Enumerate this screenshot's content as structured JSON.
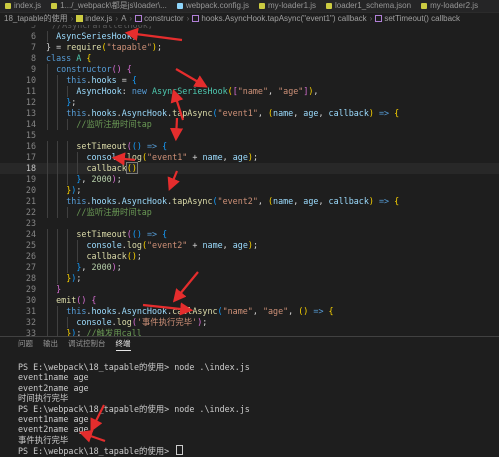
{
  "tabs": [
    {
      "label": "index.js",
      "sub": "",
      "icon": "js-file-icon"
    },
    {
      "label": "1.../_webpack\\都是js\\loader\\...",
      "sub": "",
      "icon": "js-file-icon"
    },
    {
      "label": "webpack.config.js",
      "sub": "",
      "icon": "webpack-file-icon"
    },
    {
      "label": "my-loader1.js",
      "sub": "",
      "icon": "js-file-icon"
    },
    {
      "label": "loader1_schema.json",
      "sub": "",
      "icon": "json-file-icon"
    },
    {
      "label": "my-loader2.js",
      "sub": "",
      "icon": "js-file-icon"
    }
  ],
  "breadcrumbs": [
    "18_tapable的使用",
    "index.js",
    "A",
    "constructor",
    "hooks.AsyncHook.tapAsync(\"event1\") callback",
    "setTimeout() callback"
  ],
  "editor": {
    "active_line": "18",
    "lines": [
      {
        "n": "6",
        "indent": 1,
        "tokens": [
          [
            "tk-var",
            "AsyncSeriesHook"
          ],
          [
            "tk-pun",
            ","
          ]
        ]
      },
      {
        "n": "7",
        "indent": 0,
        "tokens": [
          [
            "tk-pun",
            "} = "
          ],
          [
            "tk-fn",
            "require"
          ],
          [
            "tk-brk",
            "("
          ],
          [
            "tk-str",
            "\"tapable\""
          ],
          [
            "tk-brk",
            ")"
          ],
          [
            "tk-pun",
            ";"
          ]
        ]
      },
      {
        "n": "8",
        "indent": 0,
        "tokens": [
          [
            "tk-key",
            "class "
          ],
          [
            "tk-cls",
            "A"
          ],
          [
            "tk-pun",
            " "
          ],
          [
            "tk-brk",
            "{"
          ]
        ]
      },
      {
        "n": "9",
        "indent": 1,
        "tokens": [
          [
            "tk-key",
            "constructor"
          ],
          [
            "tk-brk2",
            "()"
          ],
          [
            "tk-pun",
            " "
          ],
          [
            "tk-brk2",
            "{"
          ]
        ]
      },
      {
        "n": "10",
        "indent": 2,
        "tokens": [
          [
            "tk-key",
            "this"
          ],
          [
            "tk-pun",
            "."
          ],
          [
            "tk-var",
            "hooks"
          ],
          [
            "tk-pun",
            " = "
          ],
          [
            "tk-brk3",
            "{"
          ]
        ]
      },
      {
        "n": "11",
        "indent": 3,
        "tokens": [
          [
            "tk-var",
            "AsyncHook"
          ],
          [
            "tk-pun",
            ": "
          ],
          [
            "tk-key",
            "new "
          ],
          [
            "tk-cls",
            "AsyncSeriesHook"
          ],
          [
            "tk-brk",
            "("
          ],
          [
            "tk-brk2",
            "["
          ],
          [
            "tk-str",
            "\"name\""
          ],
          [
            "tk-pun",
            ", "
          ],
          [
            "tk-str",
            "\"age\""
          ],
          [
            "tk-brk2",
            "]"
          ],
          [
            "tk-brk",
            ")"
          ],
          [
            "tk-pun",
            ","
          ]
        ]
      },
      {
        "n": "12",
        "indent": 2,
        "tokens": [
          [
            "tk-brk3",
            "}"
          ],
          [
            "tk-pun",
            ";"
          ]
        ]
      },
      {
        "n": "13",
        "indent": 2,
        "tokens": [
          [
            "tk-key",
            "this"
          ],
          [
            "tk-pun",
            "."
          ],
          [
            "tk-var",
            "hooks"
          ],
          [
            "tk-pun",
            "."
          ],
          [
            "tk-var",
            "AsyncHook"
          ],
          [
            "tk-pun",
            "."
          ],
          [
            "tk-fn",
            "tapAsync"
          ],
          [
            "tk-brk3",
            "("
          ],
          [
            "tk-str",
            "\"event1\""
          ],
          [
            "tk-pun",
            ", "
          ],
          [
            "tk-brk",
            "("
          ],
          [
            "tk-var",
            "name"
          ],
          [
            "tk-pun",
            ", "
          ],
          [
            "tk-var",
            "age"
          ],
          [
            "tk-pun",
            ", "
          ],
          [
            "tk-var",
            "callback"
          ],
          [
            "tk-brk",
            ")"
          ],
          [
            "tk-pun",
            " "
          ],
          [
            "tk-key",
            "=>"
          ],
          [
            "tk-pun",
            " "
          ],
          [
            "tk-brk",
            "{"
          ]
        ]
      },
      {
        "n": "14",
        "indent": 3,
        "tokens": [
          [
            "tk-com",
            "//监听注册时间tap"
          ]
        ]
      },
      {
        "n": "15",
        "indent": 0,
        "tokens": []
      },
      {
        "n": "16",
        "indent": 3,
        "tokens": [
          [
            "tk-fn",
            "setTimeout"
          ],
          [
            "tk-brk2",
            "("
          ],
          [
            "tk-brk3",
            "()"
          ],
          [
            "tk-pun",
            " "
          ],
          [
            "tk-key",
            "=>"
          ],
          [
            "tk-pun",
            " "
          ],
          [
            "tk-brk3",
            "{"
          ]
        ]
      },
      {
        "n": "17",
        "indent": 4,
        "tokens": [
          [
            "tk-var",
            "console"
          ],
          [
            "tk-pun",
            "."
          ],
          [
            "tk-fn",
            "log"
          ],
          [
            "tk-brk",
            "("
          ],
          [
            "tk-str",
            "\"event1\""
          ],
          [
            "tk-pun",
            " + "
          ],
          [
            "tk-var",
            "name"
          ],
          [
            "tk-pun",
            ", "
          ],
          [
            "tk-var",
            "age"
          ],
          [
            "tk-brk",
            ")"
          ],
          [
            "tk-pun",
            ";"
          ]
        ]
      },
      {
        "n": "18",
        "indent": 4,
        "tokens": [
          [
            "tk-fn",
            "callback"
          ],
          [
            "tk-brk",
            "()"
          ]
        ]
      },
      {
        "n": "19",
        "indent": 3,
        "tokens": [
          [
            "tk-brk3",
            "}"
          ],
          [
            "tk-pun",
            ", "
          ],
          [
            "tk-num",
            "2000"
          ],
          [
            "tk-brk2",
            ")"
          ],
          [
            "tk-pun",
            ";"
          ]
        ]
      },
      {
        "n": "20",
        "indent": 2,
        "tokens": [
          [
            "tk-brk",
            "}"
          ],
          [
            "tk-brk3",
            ")"
          ],
          [
            "tk-pun",
            ";"
          ]
        ]
      },
      {
        "n": "21",
        "indent": 2,
        "tokens": [
          [
            "tk-key",
            "this"
          ],
          [
            "tk-pun",
            "."
          ],
          [
            "tk-var",
            "hooks"
          ],
          [
            "tk-pun",
            "."
          ],
          [
            "tk-var",
            "AsyncHook"
          ],
          [
            "tk-pun",
            "."
          ],
          [
            "tk-fn",
            "tapAsync"
          ],
          [
            "tk-brk3",
            "("
          ],
          [
            "tk-str",
            "\"event2\""
          ],
          [
            "tk-pun",
            ", "
          ],
          [
            "tk-brk",
            "("
          ],
          [
            "tk-var",
            "name"
          ],
          [
            "tk-pun",
            ", "
          ],
          [
            "tk-var",
            "age"
          ],
          [
            "tk-pun",
            ", "
          ],
          [
            "tk-var",
            "callback"
          ],
          [
            "tk-brk",
            ")"
          ],
          [
            "tk-pun",
            " "
          ],
          [
            "tk-key",
            "=>"
          ],
          [
            "tk-pun",
            " "
          ],
          [
            "tk-brk",
            "{"
          ]
        ]
      },
      {
        "n": "22",
        "indent": 3,
        "tokens": [
          [
            "tk-com",
            "//监听注册时间tap"
          ]
        ]
      },
      {
        "n": "23",
        "indent": 0,
        "tokens": []
      },
      {
        "n": "24",
        "indent": 3,
        "tokens": [
          [
            "tk-fn",
            "setTimeout"
          ],
          [
            "tk-brk2",
            "("
          ],
          [
            "tk-brk3",
            "()"
          ],
          [
            "tk-pun",
            " "
          ],
          [
            "tk-key",
            "=>"
          ],
          [
            "tk-pun",
            " "
          ],
          [
            "tk-brk3",
            "{"
          ]
        ]
      },
      {
        "n": "25",
        "indent": 4,
        "tokens": [
          [
            "tk-var",
            "console"
          ],
          [
            "tk-pun",
            "."
          ],
          [
            "tk-fn",
            "log"
          ],
          [
            "tk-brk",
            "("
          ],
          [
            "tk-str",
            "\"event2\""
          ],
          [
            "tk-pun",
            " + "
          ],
          [
            "tk-var",
            "name"
          ],
          [
            "tk-pun",
            ", "
          ],
          [
            "tk-var",
            "age"
          ],
          [
            "tk-brk",
            ")"
          ],
          [
            "tk-pun",
            ";"
          ]
        ]
      },
      {
        "n": "26",
        "indent": 4,
        "tokens": [
          [
            "tk-fn",
            "callback"
          ],
          [
            "tk-brk",
            "()"
          ],
          [
            "tk-pun",
            ";"
          ]
        ]
      },
      {
        "n": "27",
        "indent": 3,
        "tokens": [
          [
            "tk-brk3",
            "}"
          ],
          [
            "tk-pun",
            ", "
          ],
          [
            "tk-num",
            "2000"
          ],
          [
            "tk-brk2",
            ")"
          ],
          [
            "tk-pun",
            ";"
          ]
        ]
      },
      {
        "n": "28",
        "indent": 2,
        "tokens": [
          [
            "tk-brk",
            "}"
          ],
          [
            "tk-brk3",
            ")"
          ],
          [
            "tk-pun",
            ";"
          ]
        ]
      },
      {
        "n": "29",
        "indent": 1,
        "tokens": [
          [
            "tk-brk2",
            "}"
          ]
        ]
      },
      {
        "n": "30",
        "indent": 1,
        "tokens": [
          [
            "tk-fn",
            "emit"
          ],
          [
            "tk-brk2",
            "()"
          ],
          [
            "tk-pun",
            " "
          ],
          [
            "tk-brk2",
            "{"
          ]
        ]
      },
      {
        "n": "31",
        "indent": 2,
        "tokens": [
          [
            "tk-key",
            "this"
          ],
          [
            "tk-pun",
            "."
          ],
          [
            "tk-var",
            "hooks"
          ],
          [
            "tk-pun",
            "."
          ],
          [
            "tk-var",
            "AsyncHook"
          ],
          [
            "tk-pun",
            "."
          ],
          [
            "tk-fn",
            "callAsync"
          ],
          [
            "tk-brk3",
            "("
          ],
          [
            "tk-str",
            "\"name\""
          ],
          [
            "tk-pun",
            ", "
          ],
          [
            "tk-str",
            "\"age\""
          ],
          [
            "tk-pun",
            ", "
          ],
          [
            "tk-brk",
            "()"
          ],
          [
            "tk-pun",
            " "
          ],
          [
            "tk-key",
            "=>"
          ],
          [
            "tk-pun",
            " "
          ],
          [
            "tk-brk",
            "{"
          ]
        ]
      },
      {
        "n": "32",
        "indent": 3,
        "tokens": [
          [
            "tk-var",
            "console"
          ],
          [
            "tk-pun",
            "."
          ],
          [
            "tk-fn",
            "log"
          ],
          [
            "tk-brk2",
            "("
          ],
          [
            "tk-str",
            "'事件执行完毕'"
          ],
          [
            "tk-brk2",
            ")"
          ],
          [
            "tk-pun",
            ";"
          ]
        ]
      },
      {
        "n": "33",
        "indent": 2,
        "tokens": [
          [
            "tk-brk",
            "}"
          ],
          [
            "tk-brk3",
            ")"
          ],
          [
            "tk-pun",
            "; "
          ],
          [
            "tk-com",
            "//触发用call"
          ]
        ]
      },
      {
        "n": "34",
        "indent": 1,
        "tokens": [
          [
            "tk-brk2",
            "}"
          ]
        ]
      }
    ]
  },
  "panel": {
    "tabs": [
      "问题",
      "输出",
      "调试控制台",
      "终端"
    ],
    "active_tab": "终端",
    "terminal_lines": [
      "PS E:\\webpack\\18_tapable的使用> node .\\index.js",
      "event1name age",
      "event2name age",
      "时间执行完毕",
      "PS E:\\webpack\\18_tapable的使用> node .\\index.js",
      "event1name age",
      "event2name age",
      "事件执行完毕",
      "PS E:\\webpack\\18_tapable的使用> "
    ]
  },
  "annotations": {
    "arrow_color": "#e52d2d",
    "arrow_count": "10"
  }
}
